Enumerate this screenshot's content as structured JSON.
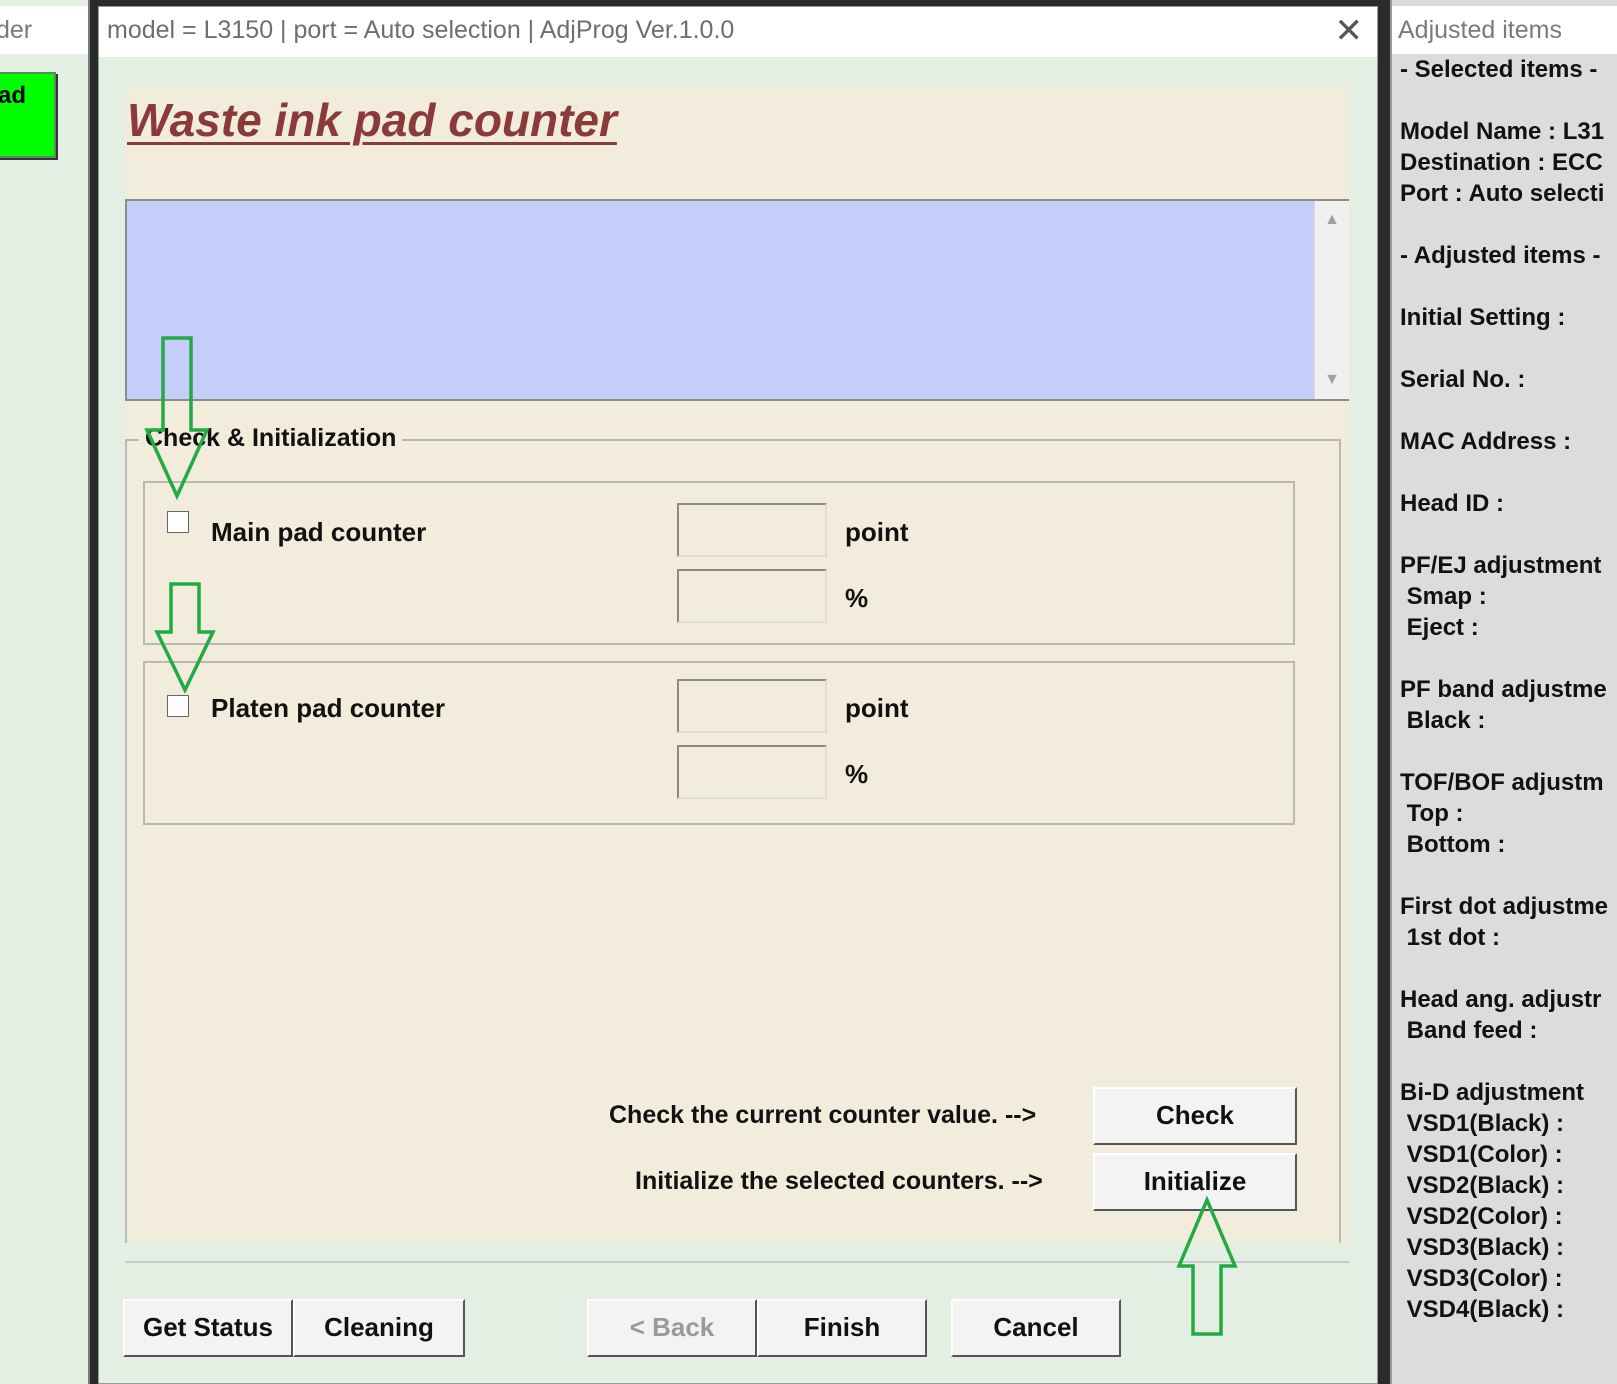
{
  "left_window": {
    "title_fragment": "der",
    "button_fragment": "ad"
  },
  "dialog": {
    "title": "model = L3150 | port = Auto selection | AdjProg Ver.1.0.0",
    "close_glyph": "✕",
    "heading": "Waste ink pad counter",
    "group_label": "Check & Initialization",
    "counters": [
      {
        "label": "Main pad counter",
        "checked": false,
        "point_value": "",
        "percent_value": "",
        "point_unit": "point",
        "percent_unit": "%"
      },
      {
        "label": "Platen pad counter",
        "checked": false,
        "point_value": "",
        "percent_value": "",
        "point_unit": "point",
        "percent_unit": "%"
      }
    ],
    "check_hint": "Check the current counter value. -->",
    "check_button": "Check",
    "initialize_hint": "Initialize the selected counters. -->",
    "initialize_button": "Initialize",
    "bottom_buttons": {
      "get_status": "Get Status",
      "cleaning": "Cleaning",
      "back": "< Back",
      "finish": "Finish",
      "cancel": "Cancel"
    }
  },
  "right_window": {
    "title": "Adjusted items",
    "lines": [
      "- Selected items -",
      "Model Name : L31",
      "Destination : ECC",
      "Port : Auto selecti",
      "- Adjusted items -",
      "Initial Setting :",
      "Serial No. :",
      "MAC Address :",
      "Head ID :",
      "PF/EJ adjustment",
      " Smap :",
      " Eject :",
      "PF band adjustme",
      " Black :",
      "TOF/BOF adjustm",
      " Top :",
      " Bottom :",
      "First dot adjustme",
      " 1st dot :",
      "Head ang. adjustr",
      " Band feed :",
      "Bi-D adjustment",
      " VSD1(Black) :",
      " VSD1(Color) :",
      " VSD2(Black) :",
      " VSD2(Color) :",
      " VSD3(Black) :",
      " VSD3(Color) :",
      " VSD4(Black) :"
    ]
  },
  "annotations": {
    "arrow_color": "#22aa44"
  }
}
